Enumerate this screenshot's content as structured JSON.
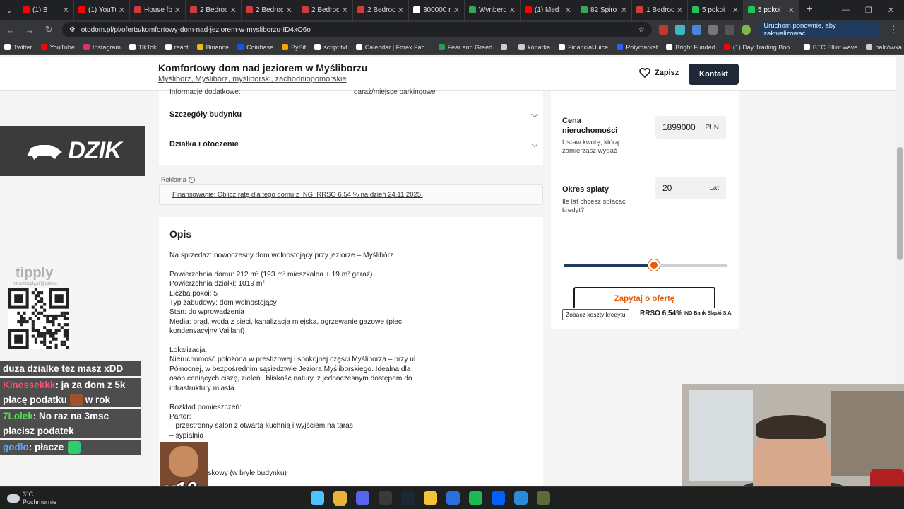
{
  "browser": {
    "tabs": [
      {
        "label": "(1) B",
        "color": "#ff0000",
        "active": false
      },
      {
        "label": "(1) YouTu",
        "color": "#ff0000",
        "active": false
      },
      {
        "label": "House fo",
        "color": "#d23b3b",
        "active": false
      },
      {
        "label": "2 Bedroo",
        "color": "#d23b3b",
        "active": false
      },
      {
        "label": "2 Bedroo",
        "color": "#d23b3b",
        "active": false
      },
      {
        "label": "2 Bedroo",
        "color": "#d23b3b",
        "active": false
      },
      {
        "label": "2 Bedroo",
        "color": "#d23b3b",
        "active": false
      },
      {
        "label": "300000 n",
        "color": "#ffffff",
        "active": false
      },
      {
        "label": "Wynberg",
        "color": "#34a853",
        "active": false
      },
      {
        "label": "(1) Med",
        "color": "#ff0000",
        "active": false
      },
      {
        "label": "82 Spiro",
        "color": "#34a853",
        "active": false
      },
      {
        "label": "1 Bedroo",
        "color": "#d23b3b",
        "active": false
      },
      {
        "label": "5 pokoi",
        "color": "#21c35a",
        "active": false
      },
      {
        "label": "5 pokoi",
        "color": "#21c35a",
        "active": true
      }
    ],
    "url": "otodom.pl/pl/oferta/komfortowy-dom-nad-jeziorem-w-mysliborzu-ID4xO6o",
    "update_button": "Uruchom ponownie, aby zaktualizować",
    "bookmarks": [
      {
        "label": "Twitter",
        "color": "#ffffff"
      },
      {
        "label": "YouTube",
        "color": "#ff0000"
      },
      {
        "label": "Instagram",
        "color": "#e1306c"
      },
      {
        "label": "TikTok",
        "color": "#ffffff"
      },
      {
        "label": "react",
        "color": "#ffffff"
      },
      {
        "label": "Binance",
        "color": "#f0b90b"
      },
      {
        "label": "Coinbase",
        "color": "#1652f0"
      },
      {
        "label": "ByBit",
        "color": "#f7a600"
      },
      {
        "label": "script.txt",
        "color": "#ffffff"
      },
      {
        "label": "Calendar | Forex Fac...",
        "color": "#ffffff"
      },
      {
        "label": "Fear and Greed",
        "color": "#2a9d55"
      },
      {
        "label": "",
        "color": "#cccccc"
      },
      {
        "label": "koparka",
        "color": "#cccccc"
      },
      {
        "label": "FinancialJuice",
        "color": "#ffffff"
      },
      {
        "label": "Polymarket",
        "color": "#2e5cff"
      },
      {
        "label": "Bright Funded",
        "color": "#ffffff"
      },
      {
        "label": "(1) Day Trading Boo...",
        "color": "#ff0000"
      },
      {
        "label": "BTC Elliot wave",
        "color": "#ffffff"
      },
      {
        "label": "palcówka",
        "color": "#cccccc"
      }
    ]
  },
  "header": {
    "title": "Komfortowy dom nad jeziorem w Myśliborzu",
    "location": "Myślibórz, Myślibórz, myśliborski, zachodniopomorskie",
    "save_label": "Zapisz",
    "contact_label": "Kontakt"
  },
  "details": {
    "cut_label": "Informacje dodatkowe:",
    "cut_value": "garaż/miejsce parkingowe",
    "sections": [
      "Szczegóły budynku",
      "Działka i otoczenie"
    ]
  },
  "ad": {
    "label": "Reklama",
    "link": "Finansowanie: Oblicz ratę dla tego domu z ING. RRSO 6,54 % na dzień 24.11.2025."
  },
  "description": {
    "title": "Opis",
    "text": "Na sprzedaż: nowoczesny dom wolnostojący przy jeziorze – Myślibórz\n\nPowierzchnia domu: 212 m² (193 m² mieszkalna + 19 m² garaż)\nPowierzchnia działki: 1019 m²\nLiczba pokoi: 5\nTyp zabudowy: dom wolnostojący\nStan: do wprowadzenia\nMedia: prąd, woda z sieci, kanalizacja miejska, ogrzewanie gazowe (piec kondensacyjny Vaillant)\n\nLokalizacja:\nNieruchomość położona w prestiżowej i spokojnej części Myśliborza – przy ul. Północnej, w bezpośrednim sąsiedztwie Jeziora Myśliborskiego. Idealna dla osób ceniących ciszę, zieleń i bliskość natury, z jednoczesnym dostępem do infrastruktury miasta.\n\nRozkład pomieszczeń:\nParter:\n– przestronny salon z otwartą kuchnią i wyjściem na taras\n– sypialnia\n\n\n– kotłownia\n– postanowiskowy (w bryle budynku)\n– toaleta"
  },
  "calculator": {
    "price_label": "Cena nieruchomości",
    "price_help": "Ustaw kwotę, którą zamierzasz wydać",
    "price_value": "1899000",
    "price_unit": "PLN",
    "term_label": "Okres spłaty",
    "term_help": "Ile lat chcesz spłacać kredyt?",
    "term_value": "20",
    "term_unit": "Lat",
    "slider_fraction": 0.55,
    "inquiry_label": "Zapytaj o ofertę",
    "credit_costs_label": "Zobacz koszty kredytu",
    "rrso": "RRSO 6,54%",
    "bank": "ING Bank Śląski S.A."
  },
  "overlay": {
    "brand": "DZIK",
    "tipply_logo": "tipply",
    "tipply_url": "https://tipply.pl/@dzikos",
    "chat": [
      {
        "user": "",
        "user_color": "#ffffff",
        "text": "duza dzialke tez masz xDD",
        "faded": false
      },
      {
        "user": "Kinessekkk",
        "user_color": "#ff4d6d",
        "text": ": ja za dom z 5k płacę podatku",
        "tail": "w rok",
        "faded": false
      },
      {
        "user": "7Lolek",
        "user_color": "#5cd65c",
        "text": ": No raz na 3msc płacisz podatek",
        "faded": false
      },
      {
        "user": "godlo",
        "user_color": "#5aa9ff",
        "text": ": płacze",
        "faded": false
      }
    ],
    "meme_text": "x10"
  },
  "taskbar": {
    "temperature": "3°C",
    "weather": "Pochmurnie",
    "icons": [
      {
        "name": "windows-start-icon",
        "color": "#4cc2ff"
      },
      {
        "name": "chrome-icon",
        "color": "#e9b23b"
      },
      {
        "name": "discord-icon",
        "color": "#5865f2"
      },
      {
        "name": "obs-icon",
        "color": "#3a3a3a"
      },
      {
        "name": "steam-icon",
        "color": "#1b2838"
      },
      {
        "name": "file-explorer-icon",
        "color": "#f3c13a"
      },
      {
        "name": "ccleaner-icon",
        "color": "#2a6fdb"
      },
      {
        "name": "spotify-icon",
        "color": "#1db954"
      },
      {
        "name": "dropbox-icon",
        "color": "#0061fe"
      },
      {
        "name": "photos-icon",
        "color": "#2a8bd8"
      },
      {
        "name": "app-icon",
        "color": "#5b6b3a"
      }
    ]
  }
}
